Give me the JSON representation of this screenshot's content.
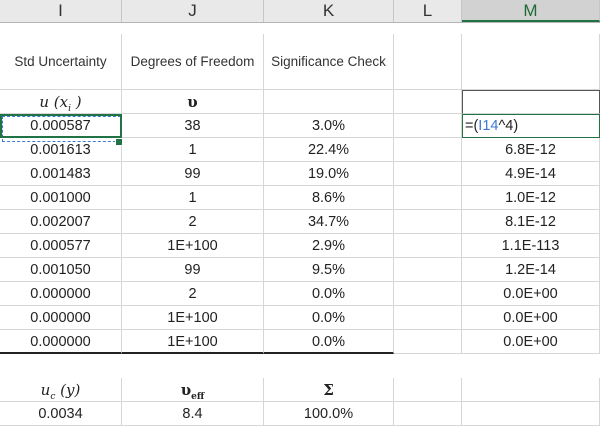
{
  "columns": [
    {
      "letter": "I"
    },
    {
      "letter": "J"
    },
    {
      "letter": "K"
    },
    {
      "letter": "L"
    },
    {
      "letter": "M"
    }
  ],
  "headers": {
    "I": "Std Uncertainty",
    "J": "Degrees of Freedom",
    "K": "Significance Check",
    "L": "",
    "M": ""
  },
  "symbols": {
    "I": "u(x_i)",
    "J": "υ",
    "K": "",
    "M": ""
  },
  "rows": [
    {
      "I": "0.000587",
      "J": "38",
      "K": "3.0%",
      "M": "=(I14^4)"
    },
    {
      "I": "0.001613",
      "J": "1",
      "K": "22.4%",
      "M": "6.8E-12"
    },
    {
      "I": "0.001483",
      "J": "99",
      "K": "19.0%",
      "M": "4.9E-14"
    },
    {
      "I": "0.001000",
      "J": "1",
      "K": "8.6%",
      "M": "1.0E-12"
    },
    {
      "I": "0.002007",
      "J": "2",
      "K": "34.7%",
      "M": "8.1E-12"
    },
    {
      "I": "0.000577",
      "J": "1E+100",
      "K": "2.9%",
      "M": "1.1E-113"
    },
    {
      "I": "0.001050",
      "J": "99",
      "K": "9.5%",
      "M": "1.2E-14"
    },
    {
      "I": "0.000000",
      "J": "2",
      "K": "0.0%",
      "M": "0.0E+00"
    },
    {
      "I": "0.000000",
      "J": "1E+100",
      "K": "0.0%",
      "M": "0.0E+00"
    },
    {
      "I": "0.000000",
      "J": "1E+100",
      "K": "0.0%",
      "M": "0.0E+00"
    }
  ],
  "summary_symbols": {
    "I": "u_c(y)",
    "J": "υ_eff",
    "K": "Σ"
  },
  "summary_values": {
    "I": "0.0034",
    "J": "8.4",
    "K": "100.0%"
  },
  "editing_formula": {
    "prefix": "=(",
    "ref": "I14",
    "suffix": "^4)"
  },
  "colors": {
    "selection": "#217346",
    "reference": "#3a7bd5"
  }
}
